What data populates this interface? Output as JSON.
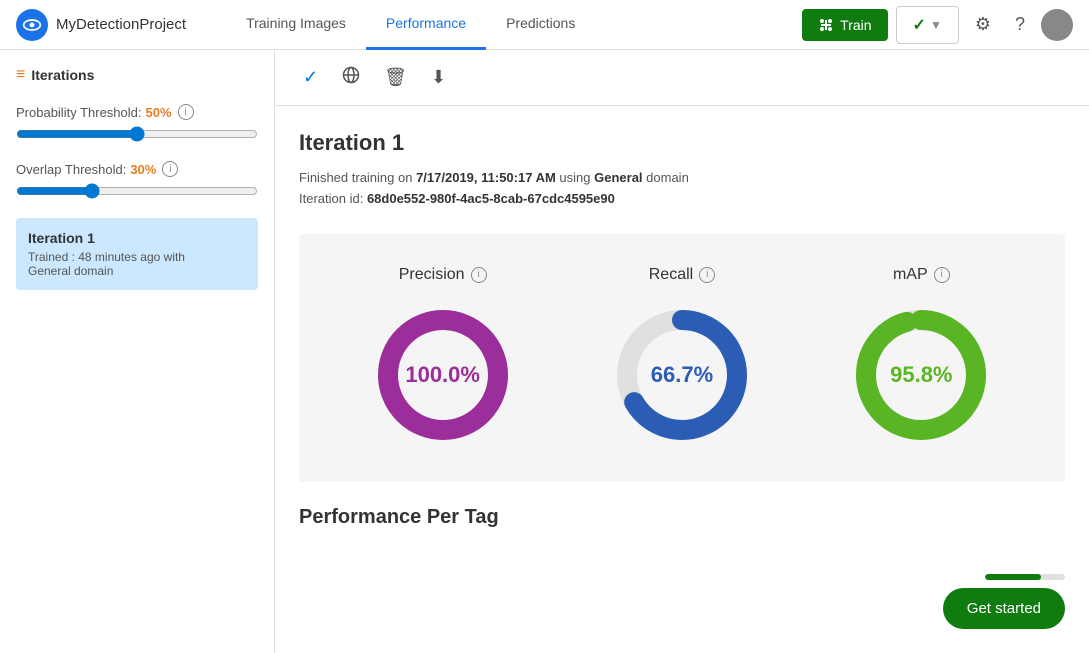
{
  "header": {
    "logo_symbol": "👁",
    "project_name": "MyDetectionProject",
    "tabs": [
      {
        "label": "Training Images",
        "active": false
      },
      {
        "label": "Performance",
        "active": true
      },
      {
        "label": "Predictions",
        "active": false
      }
    ],
    "train_button_label": "Train",
    "check_button_label": "✓",
    "settings_icon": "⚙",
    "help_icon": "?"
  },
  "sidebar": {
    "title": "Iterations",
    "probability_threshold": {
      "label": "Probability Threshold:",
      "value": "50%",
      "percent": 50
    },
    "overlap_threshold": {
      "label": "Overlap Threshold:",
      "value": "30%",
      "percent": 30
    },
    "iteration": {
      "title": "Iteration 1",
      "trained_ago": "Trained : 48 minutes ago with",
      "domain": "General domain"
    }
  },
  "toolbar": {
    "icons": [
      "✓",
      "🌐",
      "🗑",
      "⬇"
    ]
  },
  "content": {
    "iteration_title": "Iteration 1",
    "meta_line1_prefix": "Finished training on ",
    "meta_date": "7/17/2019, 11:50:17 AM",
    "meta_line1_middle": " using ",
    "meta_domain": "General",
    "meta_line1_suffix": " domain",
    "meta_line2_prefix": "Iteration id: ",
    "meta_id": "68d0e552-980f-4ac5-8cab-67cdc4595e90",
    "precision": {
      "label": "Precision",
      "value": "100.0%",
      "color": "#9b2e9b",
      "percent": 100
    },
    "recall": {
      "label": "Recall",
      "value": "66.7%",
      "color": "#2b5db5",
      "percent": 66.7
    },
    "map": {
      "label": "mAP",
      "value": "95.8%",
      "color": "#5ab525",
      "percent": 95.8
    },
    "perf_per_tag_label": "Performance Per Tag",
    "get_started_label": "Get started",
    "progress_fill_percent": 70
  }
}
